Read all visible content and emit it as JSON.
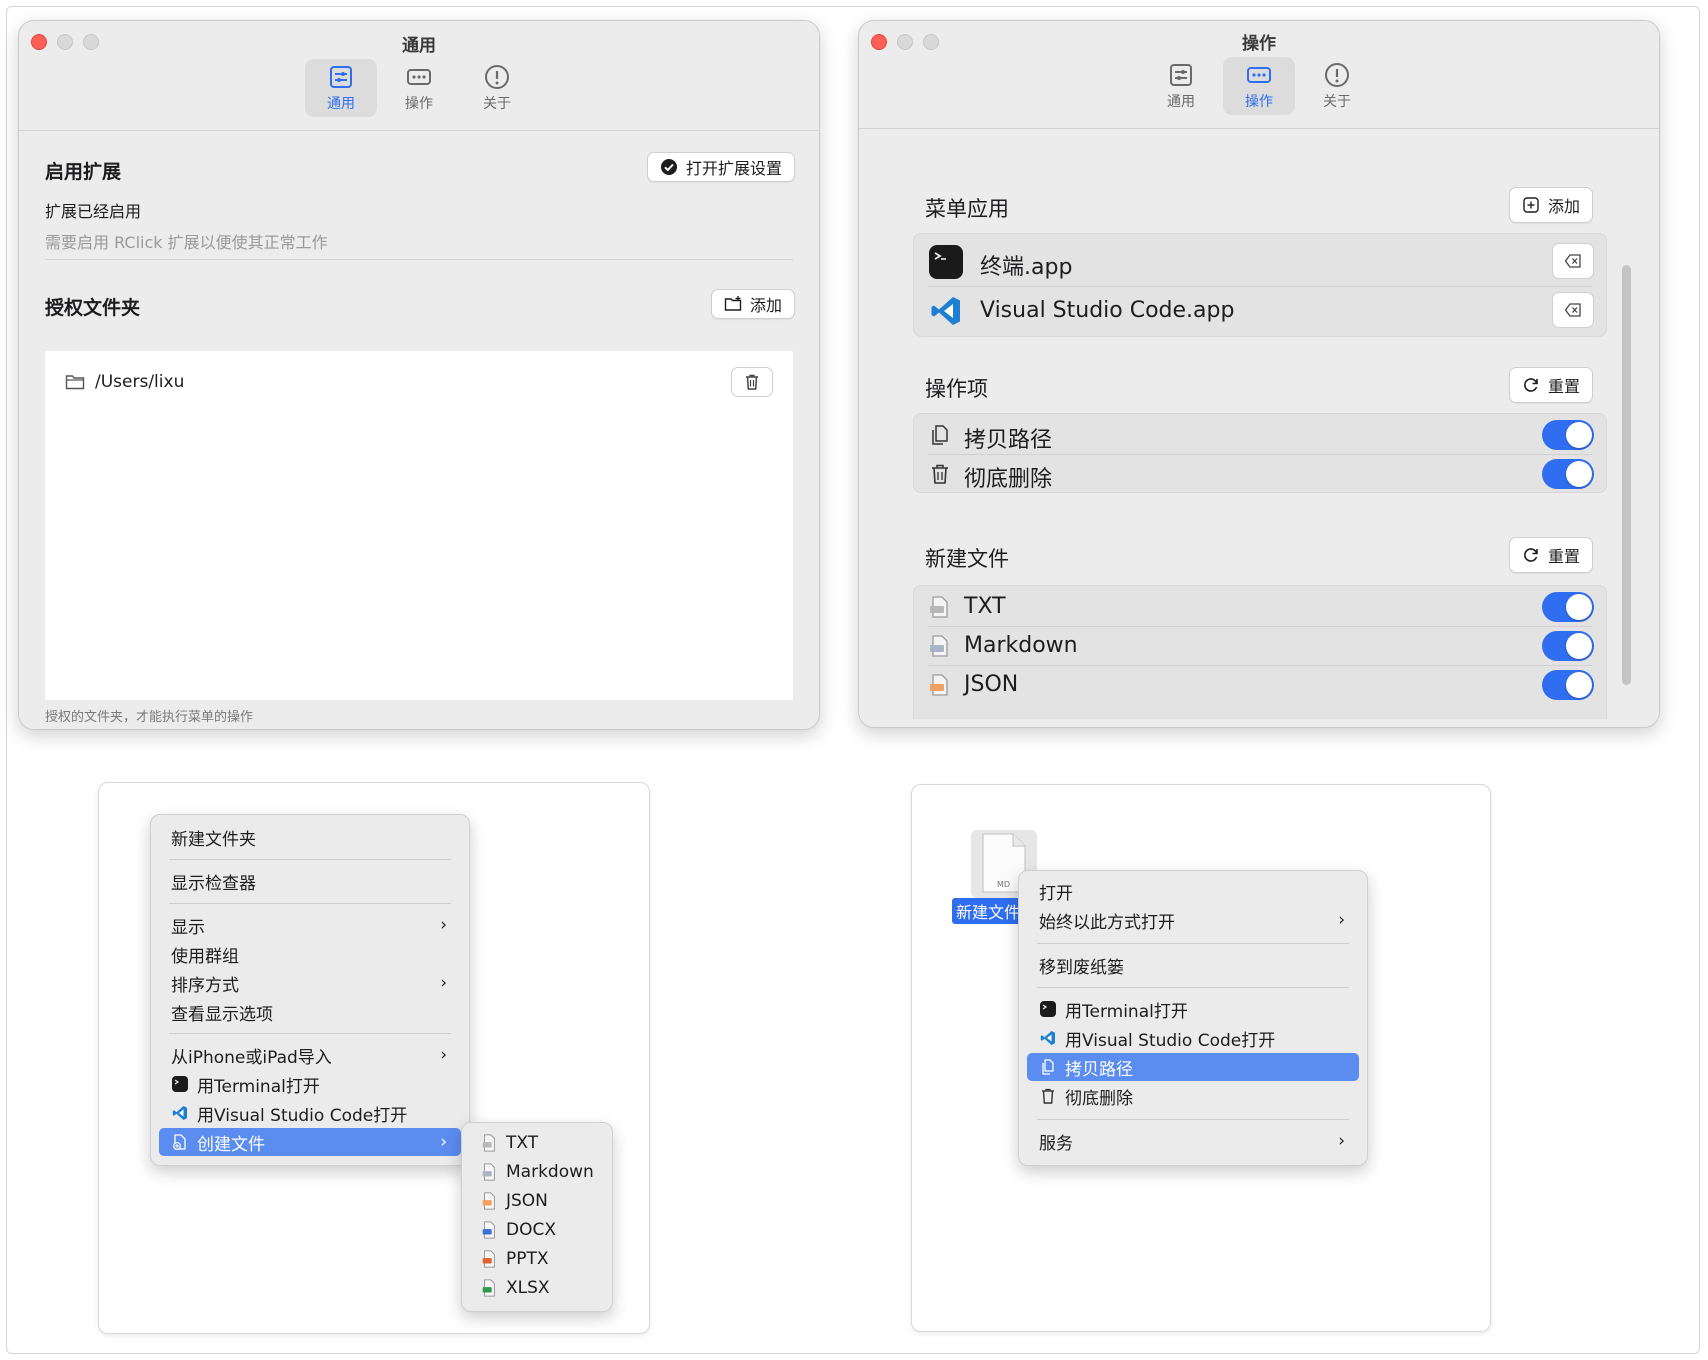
{
  "general_window": {
    "title": "通用",
    "tabs": [
      {
        "label": "通用"
      },
      {
        "label": "操作"
      },
      {
        "label": "关于"
      }
    ],
    "enable_extension": {
      "heading": "启用扩展",
      "button": "打开扩展设置",
      "status": "扩展已经启用",
      "hint": "需要启用 RClick 扩展以便使其正常工作"
    },
    "authorized_folders": {
      "heading": "授权文件夹",
      "add_button": "添加",
      "items": [
        {
          "path": "/Users/lixu"
        }
      ],
      "footer": "授权的文件夹，才能执行菜单的操作"
    }
  },
  "actions_window": {
    "title": "操作",
    "tabs": [
      {
        "label": "通用"
      },
      {
        "label": "操作"
      },
      {
        "label": "关于"
      }
    ],
    "menu_apps": {
      "heading": "菜单应用",
      "add_button": "添加",
      "items": [
        {
          "name": "终端.app"
        },
        {
          "name": "Visual Studio Code.app"
        }
      ]
    },
    "action_items": {
      "heading": "操作项",
      "reset_button": "重置",
      "items": [
        {
          "label": "拷贝路径",
          "enabled": true
        },
        {
          "label": "彻底删除",
          "enabled": true
        }
      ]
    },
    "new_files": {
      "heading": "新建文件",
      "reset_button": "重置",
      "items": [
        {
          "label": "TXT",
          "enabled": true
        },
        {
          "label": "Markdown",
          "enabled": true
        },
        {
          "label": "JSON",
          "enabled": true
        }
      ]
    }
  },
  "context_menu_left": {
    "items": [
      {
        "label": "新建文件夹"
      },
      {
        "label": "显示检查器"
      },
      {
        "label": "显示"
      },
      {
        "label": "使用群组"
      },
      {
        "label": "排序方式"
      },
      {
        "label": "查看显示选项"
      },
      {
        "label": "从iPhone或iPad导入"
      },
      {
        "label": "用Terminal打开"
      },
      {
        "label": "用Visual Studio Code打开"
      },
      {
        "label": "创建文件"
      }
    ],
    "submenu": [
      {
        "label": "TXT"
      },
      {
        "label": "Markdown"
      },
      {
        "label": "JSON"
      },
      {
        "label": "DOCX"
      },
      {
        "label": "PPTX"
      },
      {
        "label": "XLSX"
      }
    ]
  },
  "context_menu_right": {
    "file_name": "新建文件",
    "file_badge": "MD",
    "items": [
      {
        "label": "打开"
      },
      {
        "label": "始终以此方式打开"
      },
      {
        "label": "移到废纸篓"
      },
      {
        "label": "用Terminal打开"
      },
      {
        "label": "用Visual Studio Code打开"
      },
      {
        "label": "拷贝路径"
      },
      {
        "label": "彻底删除"
      },
      {
        "label": "服务"
      }
    ]
  },
  "colors": {
    "accent": "#2f6ef0",
    "selection": "#5b8cf0",
    "close": "#ff5f57"
  }
}
